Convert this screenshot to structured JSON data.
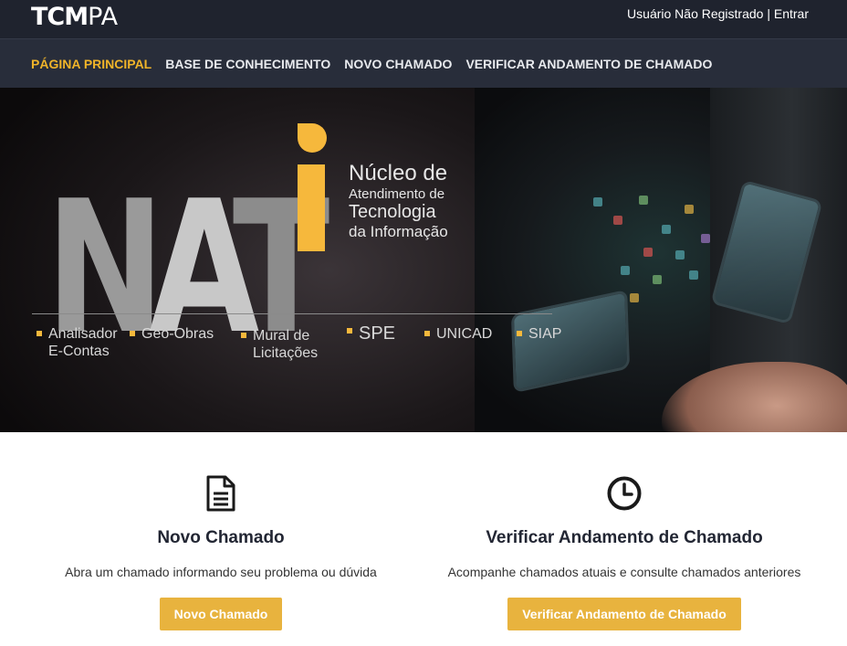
{
  "header": {
    "logo_bold": "TCM",
    "logo_light": "PA",
    "user_status": "Usuário Não Registrado",
    "separator": "|",
    "login_link": "Entrar"
  },
  "nav": {
    "items": [
      {
        "label": "PÁGINA PRINCIPAL",
        "active": true
      },
      {
        "label": "BASE DE CONHECIMENTO",
        "active": false
      },
      {
        "label": "NOVO CHAMADO",
        "active": false
      },
      {
        "label": "VERIFICAR ANDAMENTO DE CHAMADO",
        "active": false
      }
    ]
  },
  "banner": {
    "logo_text": "NAT",
    "caption_line1": "Núcleo de",
    "caption_line2": "Atendimento de",
    "caption_line3": "Tecnologia",
    "caption_line4": "da Informação",
    "systems": [
      {
        "line1": "Analisador",
        "line2": "E-Contas"
      },
      {
        "line1": "Geo-Obras",
        "line2": ""
      },
      {
        "line1": "Mural de",
        "line2": "Licitações"
      },
      {
        "line1": "SPE",
        "line2": ""
      },
      {
        "line1": "UNICAD",
        "line2": ""
      },
      {
        "line1": "SIAP",
        "line2": ""
      }
    ],
    "accent_color": "#f6b83c"
  },
  "cards": [
    {
      "icon": "document-icon",
      "title": "Novo Chamado",
      "description": "Abra um chamado informando seu problema ou dúvida",
      "button_label": "Novo Chamado"
    },
    {
      "icon": "clock-icon",
      "title": "Verificar Andamento de Chamado",
      "description": "Acompanhe chamados atuais e consulte chamados anteriores",
      "button_label": "Verificar Andamento de Chamado"
    }
  ],
  "colors": {
    "topbar": "#1f232e",
    "navbar": "#282d3a",
    "nav_active": "#f0b429",
    "button": "#e8b33e"
  }
}
